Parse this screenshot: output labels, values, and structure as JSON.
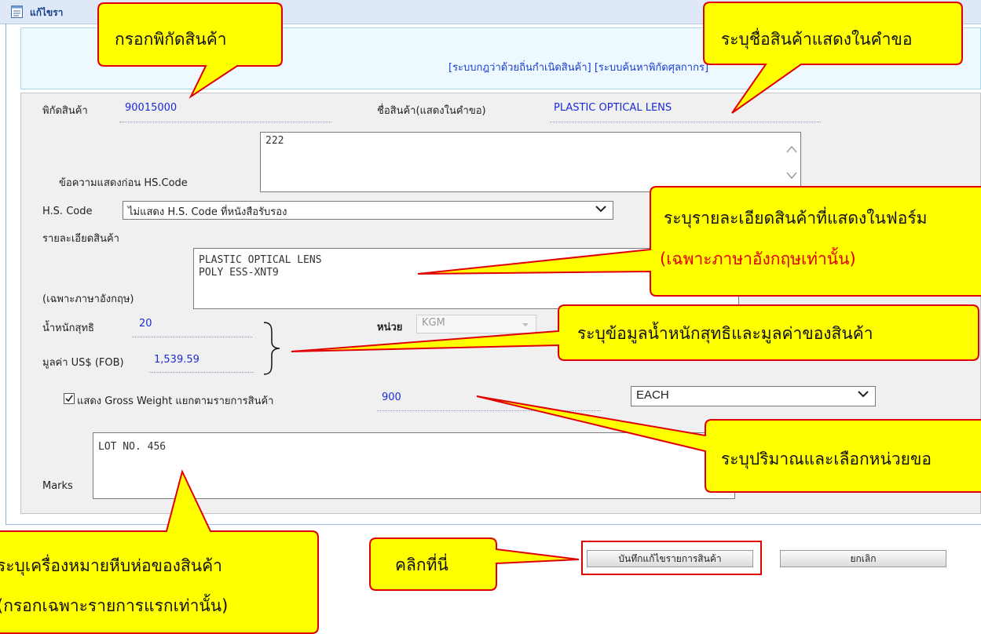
{
  "window": {
    "title": "แก้ไขรา"
  },
  "links": "[ระบบกฎว่าด้วยถิ่นกำเนิดสินค้า] [ระบบค้นหาพิกัดศุลกากร]",
  "form": {
    "hs_code_label": "พิกัดสินค้า",
    "hs_code_value": "90015000",
    "product_name_label": "ชื่อสินค้า(แสดงในคำขอ)",
    "product_name_value": "PLASTIC OPTICAL LENS",
    "pre_hs_text_label": "ข้อความแสดงก่อน HS.Code",
    "pre_hs_text_value": "222",
    "hs_select_label": "H.S. Code",
    "hs_select_value": "ไม่แสดง H.S. Code ที่หนังสือรับรอง",
    "description_label": "รายละเอียดสินค้า",
    "description_note": "(เฉพาะภาษาอังกฤษ)",
    "description_value": "PLASTIC OPTICAL LENS\nPOLY ESS-XNT9",
    "net_weight_label": "น้ำหนักสุทธิ",
    "net_weight_value": "20",
    "unit_label": "หน่วย",
    "unit_value": "KGM",
    "fob_label": "มูลค่า US$ (FOB)",
    "fob_value": "1,539.59",
    "gross_weight_label": "แสดง Gross Weight แยกตามรายการสินค้า",
    "gross_weight_checked": true,
    "quantity_value": "900",
    "quantity_unit_value": "EACH",
    "marks_label": "Marks",
    "marks_value": "LOT NO. 456"
  },
  "buttons": {
    "save_label": "บันทึกแก้ไขรายการสินค้า",
    "cancel_label": "ยกเลิก"
  },
  "callouts": {
    "enter_hs": "กรอกพิกัดสินค้า",
    "product_name": "ระบุชื่อสินค้าแสดงในคำขอ",
    "description_line1": "ระบุรายละเอียดสินค้าที่แสดงในฟอร์ม",
    "description_line2": "(เฉพาะภาษาอังกฤษเท่านั้น)",
    "weight_value": "ระบุข้อมูลน้ำหนักสุทธิและมูลค่าของสินค้า",
    "quantity_unit": "ระบุปริมาณและเลือกหน่วยขอ",
    "marks_line1": "ระบุเครื่องหมายหีบห่อของสินค้า",
    "marks_line2": "(กรอกเฉพาะรายการแรกเท่านั้น)",
    "click_here": "คลิกที่นี่"
  },
  "colors": {
    "callout_fill": "#ffff00",
    "callout_stroke": "#e00000",
    "value_text": "#1a2ad8",
    "link_text": "#1a3fd0",
    "note_red": "#e00000"
  }
}
